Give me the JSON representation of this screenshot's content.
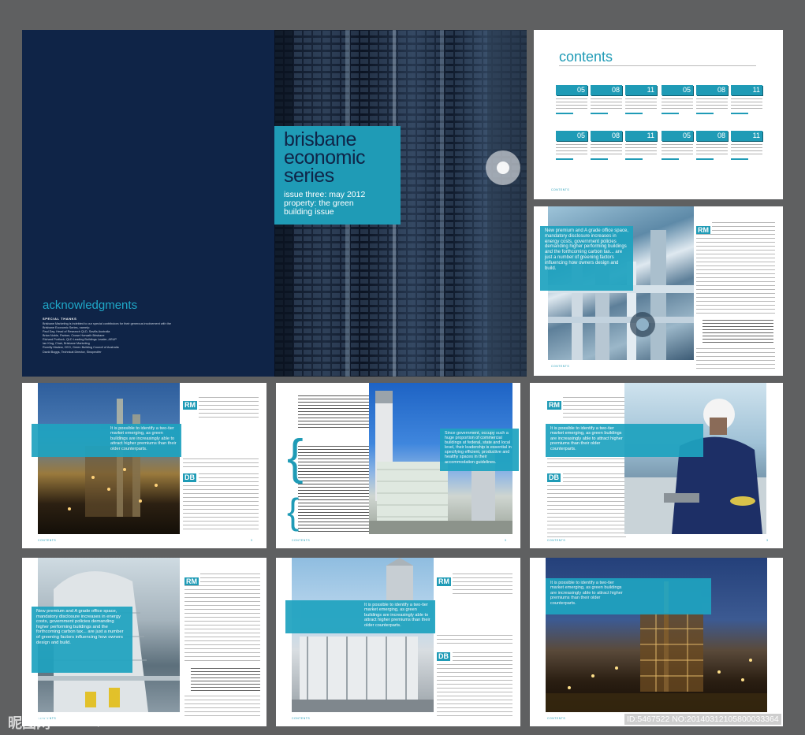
{
  "cover": {
    "title_lines": [
      "brisbane",
      "economic",
      "series"
    ],
    "subtitle_lines": [
      "issue three: may 2012",
      "property: the green",
      "building issue"
    ],
    "ack_title": "acknowledgments",
    "special_thanks": "SPECIAL THANKS",
    "ack_intro": "Brisbane Marketing is indebted to our special contributors for their generous involvement with the Brisbane Economic Series, namely:",
    "ack_list": [
      "Paul Day, Head of Research QLD, Savills Australia",
      "Brian Noble, Partner, Crowe Horwath Brisbane",
      "Richard Portlock, QLD Leading Buildings Leader, ARUP",
      "Ian Klug, Chair, Brisbane Marketing",
      "Romilly Madew, CEO, Green Building Council of Australia",
      "David Boggs, Technical Director, Sinopecifer"
    ]
  },
  "contents": {
    "title": "contents",
    "tiles": [
      {
        "num": "05"
      },
      {
        "num": "08"
      },
      {
        "num": "11"
      },
      {
        "num": "05"
      },
      {
        "num": "08"
      },
      {
        "num": "11"
      },
      {
        "num": "05"
      },
      {
        "num": "08"
      },
      {
        "num": "11"
      },
      {
        "num": "05"
      },
      {
        "num": "08"
      },
      {
        "num": "11"
      }
    ],
    "footer": "CONTENTS"
  },
  "spread2": {
    "quote": "New premium and A grade office space, mandatory disclosure increases in energy costs, government policies demanding higher performing buildings and the forthcoming carbon tax... are just a number of greening factors influencing how owners design and build.",
    "dropcap": "RM",
    "footer": "CONTENTS"
  },
  "row2": {
    "a": {
      "dropcap1": "RM",
      "band": "It is possible to identify a two-tier market emerging, as green buildings are increasingly able to attract higher premiums than their older counterparts.",
      "dropcap2": "DB",
      "footer": "CONTENTS",
      "pgnum": "3"
    },
    "b": {
      "band": "Since government, occupy such a huge proportion of commercial buildings at federal, state and local level, their leadership is essential in specifying efficient, productive and healthy spaces in their accommodation guidelines.",
      "footer": "CONTENTS",
      "pgnum": "3"
    },
    "c": {
      "dropcap1": "RM",
      "band": "It is possible to identify a two-tier market emerging, as green buildings are increasingly able to attract higher premiums than their older counterparts.",
      "dropcap2": "DB",
      "footer": "CONTENTS",
      "pgnum": "3"
    }
  },
  "row3": {
    "a": {
      "band": "New premium and A grade office space, mandatory disclosure increases in energy costs, government policies demanding higher performing buildings and the forthcoming carbon tax... are just a number of greening factors influencing how owners design and build.",
      "dropcap": "RM",
      "footer": "CONTENTS"
    },
    "b": {
      "dropcap1": "RM",
      "band": "It is possible to identify a two-tier market emerging, as green buildings are increasingly able to attract higher premiums than their older counterparts.",
      "dropcap2": "DB",
      "footer": "CONTENTS"
    },
    "c": {
      "band": "It is possible to identify a two-tier market emerging, as green buildings are increasingly able to attract higher premiums than their older counterparts.",
      "footer": "CONTENTS"
    }
  },
  "watermark": {
    "left": "昵图网",
    "url": "www.nipic.com",
    "id": "ID:5467522 NO:20140312105800033364"
  },
  "colors": {
    "teal": "#1f9bb6",
    "navy": "#0f2447",
    "background": "#5f6061"
  }
}
